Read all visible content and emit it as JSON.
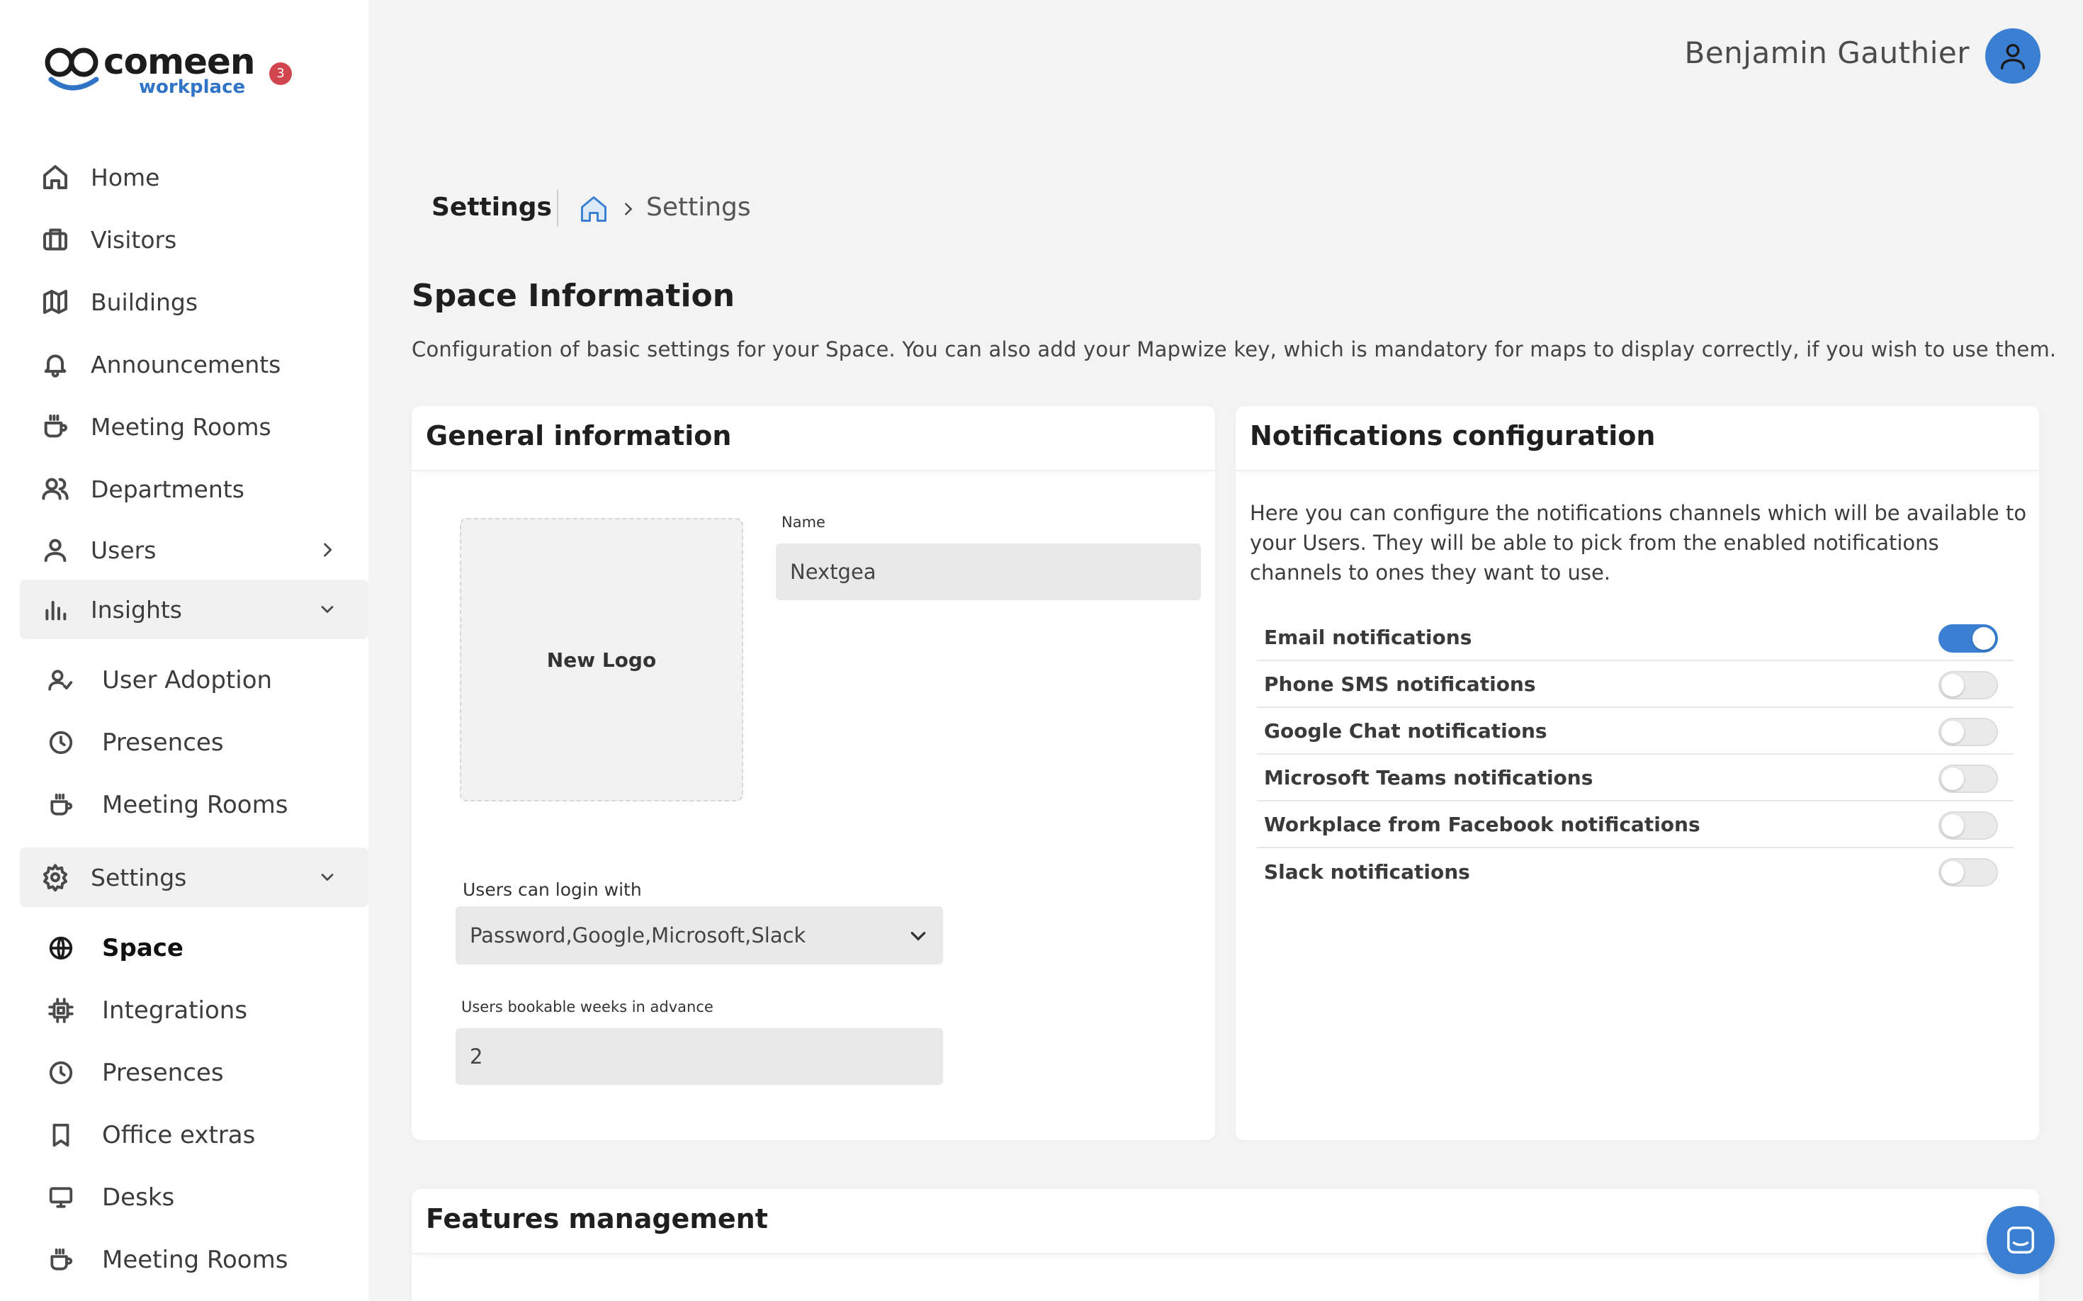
{
  "brand": {
    "name": "comeen",
    "subtitle": "workplace",
    "notification_count": "3",
    "accent_color": "#3a7fd2",
    "badge_color": "#d1454f"
  },
  "header": {
    "user_name": "Benjamin Gauthier"
  },
  "sidebar": {
    "items": [
      {
        "label": "Home",
        "icon": "home-icon"
      },
      {
        "label": "Visitors",
        "icon": "briefcase-icon"
      },
      {
        "label": "Buildings",
        "icon": "map-icon"
      },
      {
        "label": "Announcements",
        "icon": "bell-icon"
      },
      {
        "label": "Meeting Rooms",
        "icon": "cup-icon"
      },
      {
        "label": "Departments",
        "icon": "users-icon"
      },
      {
        "label": "Users",
        "icon": "user-icon"
      },
      {
        "label": "Insights",
        "icon": "bar-chart-icon"
      }
    ],
    "insights_sub": [
      {
        "label": "User Adoption",
        "icon": "user-check-icon"
      },
      {
        "label": "Presences",
        "icon": "clock-icon"
      },
      {
        "label": "Meeting Rooms",
        "icon": "cup-icon"
      }
    ],
    "settings": {
      "label": "Settings",
      "icon": "gear-icon"
    },
    "settings_sub": [
      {
        "label": "Space",
        "icon": "globe-icon",
        "active": true
      },
      {
        "label": "Integrations",
        "icon": "chip-icon"
      },
      {
        "label": "Presences",
        "icon": "clock-icon"
      },
      {
        "label": "Office extras",
        "icon": "bookmark-icon"
      },
      {
        "label": "Desks",
        "icon": "monitor-icon"
      },
      {
        "label": "Meeting Rooms",
        "icon": "cup-icon"
      }
    ]
  },
  "breadcrumb": {
    "title": "Settings",
    "current": "Settings"
  },
  "space": {
    "title": "Space Information",
    "description": "Configuration of basic settings for your Space. You can also add your Mapwize key, which is mandatory for maps to display correctly, if you wish to use them."
  },
  "general": {
    "title": "General information",
    "logo_label": "New Logo",
    "name_label": "Name",
    "name_value": "Nextgea",
    "login_label": "Users can login with",
    "login_value": "Password,Google,Microsoft,Slack",
    "weeks_label": "Users bookable weeks in advance",
    "weeks_value": "2"
  },
  "notifications": {
    "title": "Notifications configuration",
    "description": "Here you can configure the notifications channels which will be available to your Users. They will be able to pick from the enabled notifications channels to ones they want to use.",
    "channels": [
      {
        "label": "Email notifications",
        "enabled": true
      },
      {
        "label": "Phone SMS notifications",
        "enabled": false
      },
      {
        "label": "Google Chat notifications",
        "enabled": false
      },
      {
        "label": "Microsoft Teams notifications",
        "enabled": false
      },
      {
        "label": "Workplace from Facebook notifications",
        "enabled": false
      },
      {
        "label": "Slack notifications",
        "enabled": false
      }
    ]
  },
  "features": {
    "title": "Features management"
  }
}
